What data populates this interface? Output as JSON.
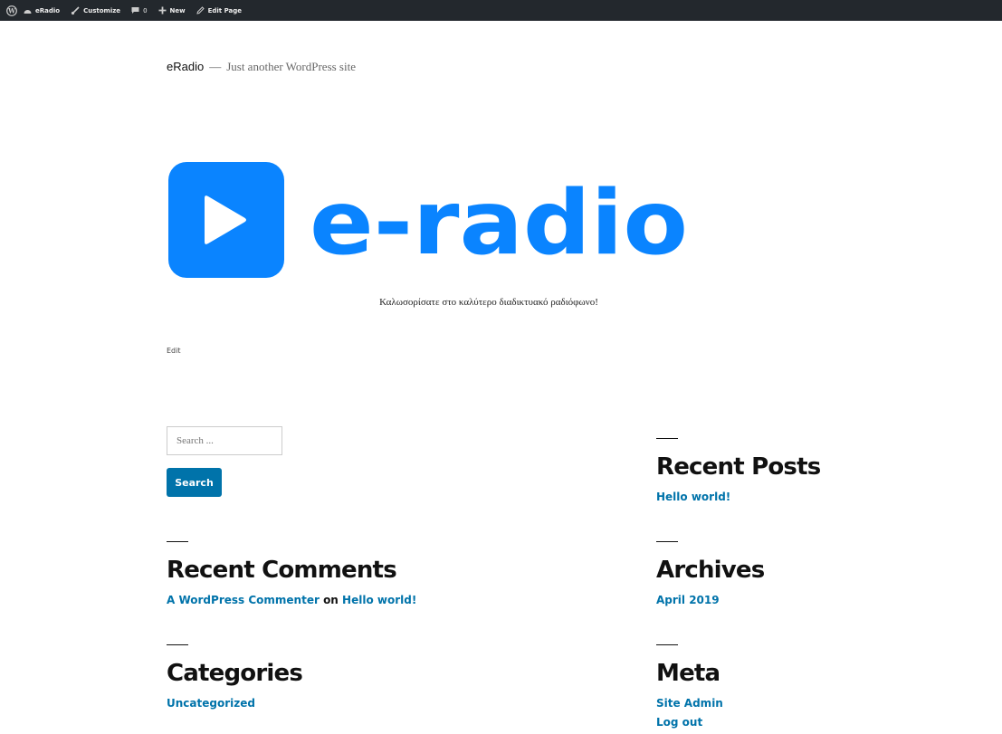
{
  "adminbar": {
    "site_label": "eRadio",
    "customize_label": "Customize",
    "comments_count": "0",
    "new_label": "New",
    "edit_page_label": "Edit Page"
  },
  "header": {
    "site_title": "eRadio",
    "separator": "—",
    "description": "Just another WordPress site"
  },
  "logo": {
    "text": "e-radio",
    "color": "#0a84ff"
  },
  "content": {
    "tagline": "Καλωσορίσατε στο καλύτερο διαδικτυακό ραδιόφωνο!",
    "edit_label": "Edit"
  },
  "search": {
    "placeholder": "Search ...",
    "button_label": "Search"
  },
  "widgets": {
    "recent_comments": {
      "title": "Recent Comments",
      "author": "A WordPress Commenter",
      "on": "on",
      "post": "Hello world!"
    },
    "categories": {
      "title": "Categories",
      "items": [
        "Uncategorized"
      ]
    },
    "recent_posts": {
      "title": "Recent Posts",
      "items": [
        "Hello world!"
      ]
    },
    "archives": {
      "title": "Archives",
      "items": [
        "April 2019"
      ]
    },
    "meta": {
      "title": "Meta",
      "items": [
        "Site Admin",
        "Log out"
      ]
    }
  },
  "colors": {
    "link": "#0073aa",
    "adminbar_bg": "#23282d"
  }
}
